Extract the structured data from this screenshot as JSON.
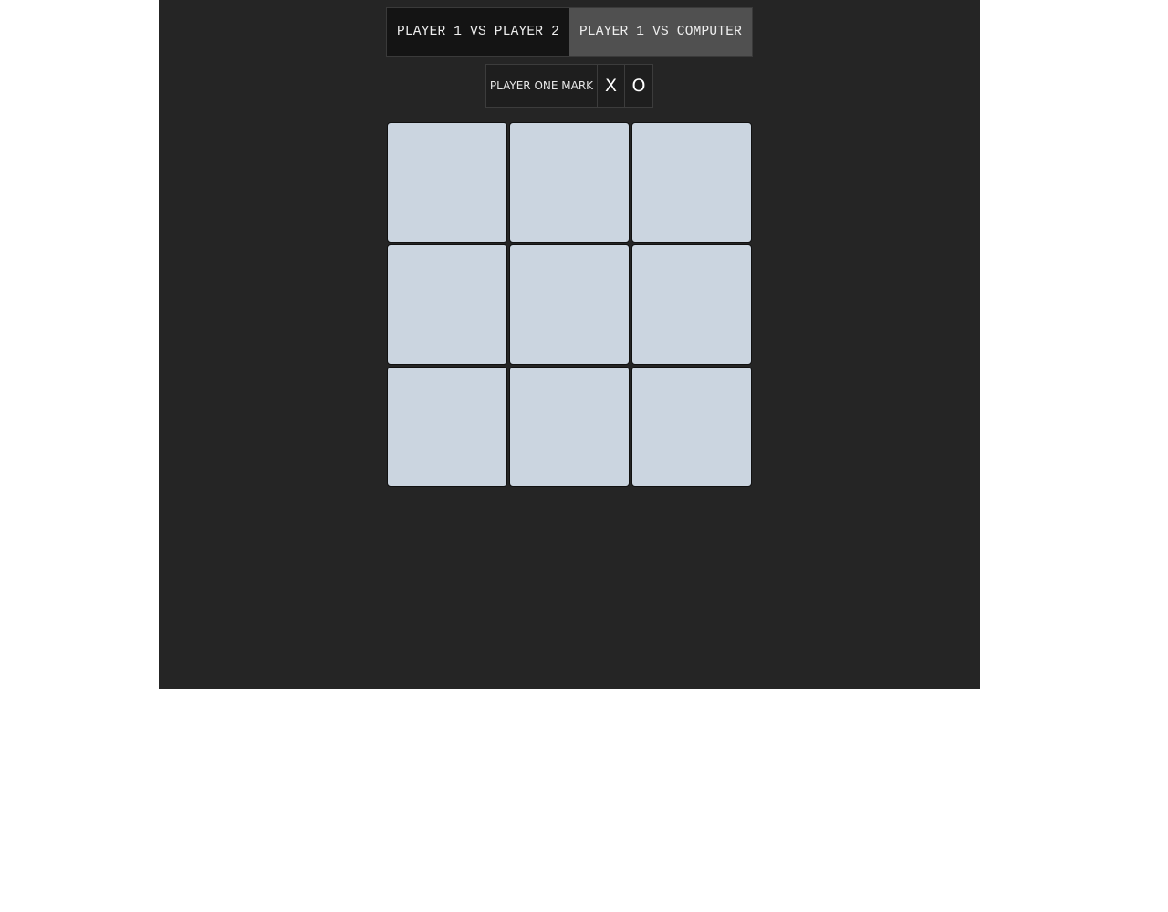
{
  "modes": {
    "pvp_label": "PLAYER 1 VS PLAYER 2",
    "pvc_label": "PLAYER 1 VS COMPUTER"
  },
  "mark_selector": {
    "label": "PLAYER ONE MARK",
    "options": [
      "X",
      "O"
    ]
  },
  "board": {
    "cells": [
      "",
      "",
      "",
      "",
      "",
      "",
      "",
      "",
      ""
    ]
  },
  "colors": {
    "app_background": "#252525",
    "cell_background": "#cbd5e0",
    "pvp_button": "#141414",
    "pvc_button": "#505050"
  }
}
